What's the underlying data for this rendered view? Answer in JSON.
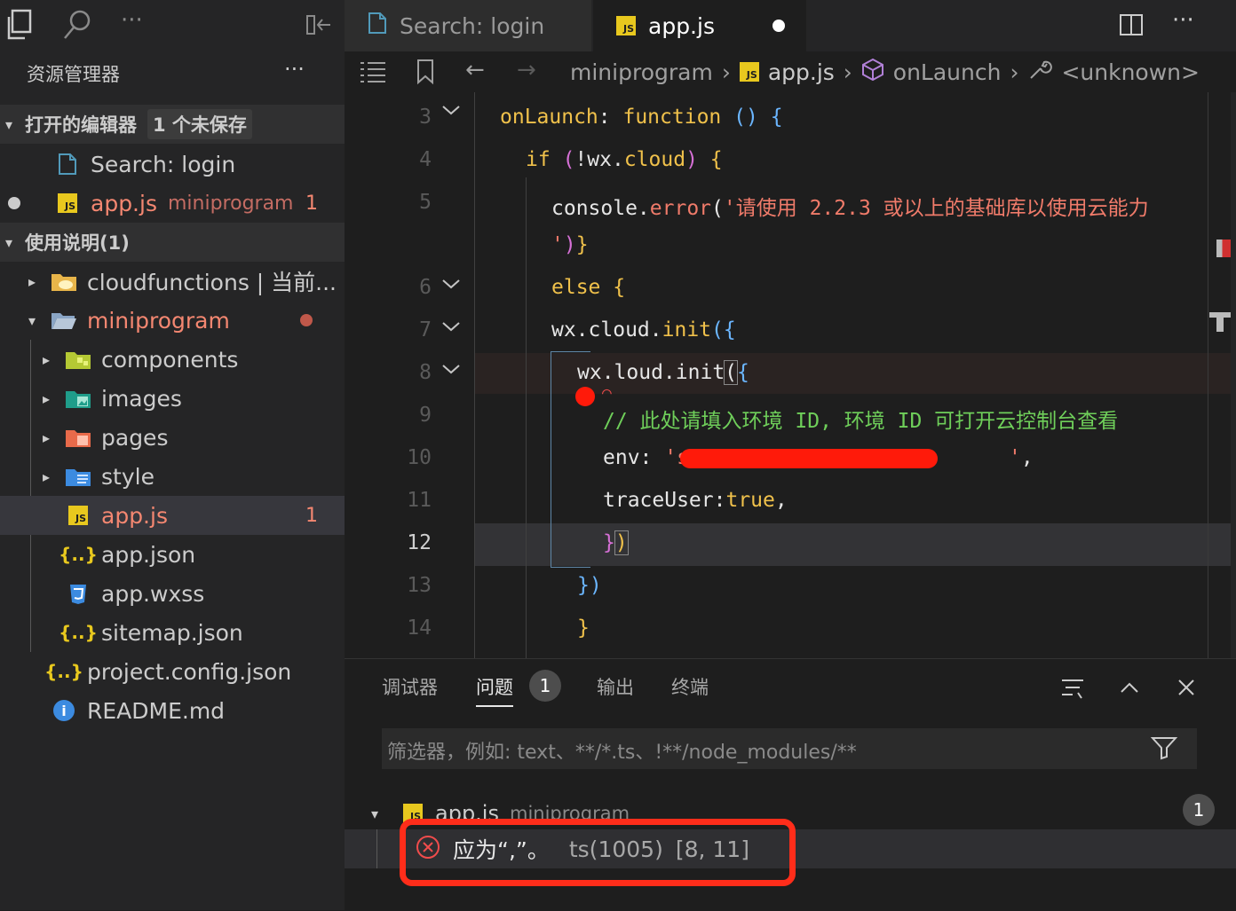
{
  "sidebar": {
    "title": "资源管理器",
    "open_editors": {
      "label": "打开的编辑器",
      "badge": "1 个未保存",
      "items": [
        {
          "label": "Search: login",
          "suffix": "",
          "count": ""
        },
        {
          "label": "app.js",
          "suffix": "miniprogram",
          "count": "1"
        }
      ]
    },
    "workspace": {
      "label": "使用说明(1)",
      "items": [
        {
          "label": "cloudfunctions | 当前..."
        },
        {
          "label": "miniprogram"
        },
        {
          "label": "components"
        },
        {
          "label": "images"
        },
        {
          "label": "pages"
        },
        {
          "label": "style"
        },
        {
          "label": "app.js",
          "count": "1"
        },
        {
          "label": "app.json"
        },
        {
          "label": "app.wxss"
        },
        {
          "label": "sitemap.json"
        },
        {
          "label": "project.config.json"
        },
        {
          "label": "README.md"
        }
      ]
    }
  },
  "tabs": [
    {
      "label": "Search: login"
    },
    {
      "label": "app.js"
    }
  ],
  "breadcrumb": {
    "items": [
      "miniprogram",
      "app.js",
      "onLaunch",
      "<unknown>"
    ]
  },
  "editor": {
    "line_numbers": [
      "3",
      "4",
      "5",
      "",
      "6",
      "7",
      "8",
      "9",
      "10",
      "11",
      "12",
      "13",
      "14"
    ],
    "current_line": "12"
  },
  "panel": {
    "tabs": [
      {
        "label": "调试器"
      },
      {
        "label": "问题",
        "count": "1"
      },
      {
        "label": "输出"
      },
      {
        "label": "终端"
      }
    ],
    "filter_placeholder": "筛选器，例如: text、**/*.ts、!**/node_modules/**",
    "problem_file": {
      "name": "app.js",
      "folder": "miniprogram",
      "count": "1"
    },
    "problem": {
      "message": "应为“,”。",
      "code": "ts(1005)",
      "position": "[8, 11]"
    }
  },
  "colors": {
    "accent": "#007acc",
    "error": "#f14c4c",
    "annotation_red": "#ff2d1a"
  }
}
